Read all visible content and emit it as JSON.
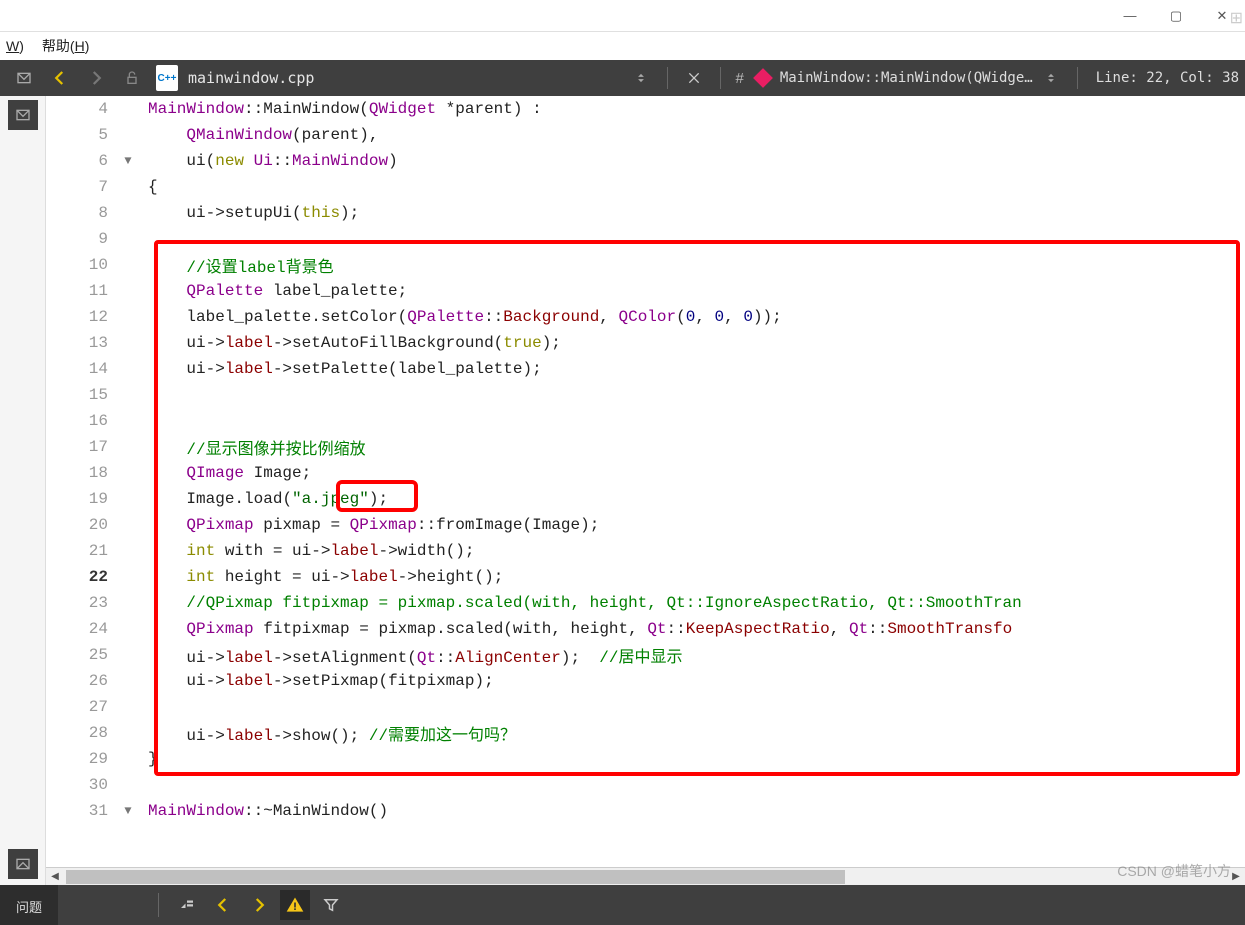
{
  "titlebar": {
    "min": "—",
    "max": "▢",
    "close": "✕"
  },
  "menu": {
    "item1_pre": "",
    "item1_u": "W",
    "item1_post": ")",
    "item2_pre": "帮助(",
    "item2_u": "H",
    "item2_post": ")"
  },
  "toolbar": {
    "filebadge": "C++",
    "filename": "mainwindow.cpp",
    "hash": "#",
    "symbol": "MainWindow::MainWindow(QWidge…",
    "lineinfo": "Line: 22, Col: 38"
  },
  "lines": [
    {
      "n": 4
    },
    {
      "n": 5
    },
    {
      "n": 6,
      "fold": true
    },
    {
      "n": 7
    },
    {
      "n": 8
    },
    {
      "n": 9
    },
    {
      "n": 10
    },
    {
      "n": 11
    },
    {
      "n": 12
    },
    {
      "n": 13
    },
    {
      "n": 14
    },
    {
      "n": 15
    },
    {
      "n": 16
    },
    {
      "n": 17
    },
    {
      "n": 18
    },
    {
      "n": 19
    },
    {
      "n": 20
    },
    {
      "n": 21
    },
    {
      "n": 22,
      "current": true
    },
    {
      "n": 23
    },
    {
      "n": 24
    },
    {
      "n": 25
    },
    {
      "n": 26
    },
    {
      "n": 27
    },
    {
      "n": 28
    },
    {
      "n": 29
    },
    {
      "n": 30
    },
    {
      "n": 31,
      "fold": true
    }
  ],
  "code": {
    "l4": [
      [
        "type",
        "MainWindow"
      ],
      [
        "op",
        "::"
      ],
      [
        "id",
        "MainWindow"
      ],
      [
        "op",
        "("
      ],
      [
        "type",
        "QWidget"
      ],
      [
        "op",
        " *"
      ],
      [
        "id",
        "parent"
      ],
      [
        "op",
        ") :"
      ]
    ],
    "l5": [
      [
        "op",
        "    "
      ],
      [
        "type",
        "QMainWindow"
      ],
      [
        "op",
        "("
      ],
      [
        "id",
        "parent"
      ],
      [
        "op",
        "),"
      ]
    ],
    "l6": [
      [
        "op",
        "    "
      ],
      [
        "id",
        "ui"
      ],
      [
        "op",
        "("
      ],
      [
        "key",
        "new"
      ],
      [
        "op",
        " "
      ],
      [
        "type",
        "Ui"
      ],
      [
        "op",
        "::"
      ],
      [
        "type",
        "MainWindow"
      ],
      [
        "op",
        ")"
      ]
    ],
    "l7": [
      [
        "op",
        "{"
      ]
    ],
    "l8": [
      [
        "op",
        "    "
      ],
      [
        "id",
        "ui"
      ],
      [
        "op",
        "->"
      ],
      [
        "id",
        "setupUi"
      ],
      [
        "op",
        "("
      ],
      [
        "key",
        "this"
      ],
      [
        "op",
        ");"
      ]
    ],
    "l9": [
      [
        "op",
        ""
      ]
    ],
    "l10": [
      [
        "op",
        "    "
      ],
      [
        "cmt",
        "//设置label背景色"
      ]
    ],
    "l11": [
      [
        "op",
        "    "
      ],
      [
        "type",
        "QPalette"
      ],
      [
        "op",
        " "
      ],
      [
        "id",
        "label_palette"
      ],
      [
        "op",
        ";"
      ]
    ],
    "l12": [
      [
        "op",
        "    "
      ],
      [
        "id",
        "label_palette"
      ],
      [
        "op",
        "."
      ],
      [
        "id",
        "setColor"
      ],
      [
        "op",
        "("
      ],
      [
        "type",
        "QPalette"
      ],
      [
        "op",
        "::"
      ],
      [
        "mem",
        "Background"
      ],
      [
        "op",
        ", "
      ],
      [
        "type",
        "QColor"
      ],
      [
        "op",
        "("
      ],
      [
        "num",
        "0"
      ],
      [
        "op",
        ", "
      ],
      [
        "num",
        "0"
      ],
      [
        "op",
        ", "
      ],
      [
        "num",
        "0"
      ],
      [
        "op",
        "));"
      ]
    ],
    "l13": [
      [
        "op",
        "    "
      ],
      [
        "id",
        "ui"
      ],
      [
        "op",
        "->"
      ],
      [
        "mem",
        "label"
      ],
      [
        "op",
        "->"
      ],
      [
        "id",
        "setAutoFillBackground"
      ],
      [
        "op",
        "("
      ],
      [
        "key",
        "true"
      ],
      [
        "op",
        ");"
      ]
    ],
    "l14": [
      [
        "op",
        "    "
      ],
      [
        "id",
        "ui"
      ],
      [
        "op",
        "->"
      ],
      [
        "mem",
        "label"
      ],
      [
        "op",
        "->"
      ],
      [
        "id",
        "setPalette"
      ],
      [
        "op",
        "("
      ],
      [
        "id",
        "label_palette"
      ],
      [
        "op",
        ");"
      ]
    ],
    "l15": [
      [
        "op",
        ""
      ]
    ],
    "l16": [
      [
        "op",
        ""
      ]
    ],
    "l17": [
      [
        "op",
        "    "
      ],
      [
        "cmt",
        "//显示图像并按比例缩放"
      ]
    ],
    "l18": [
      [
        "op",
        "    "
      ],
      [
        "type",
        "QImage"
      ],
      [
        "op",
        " "
      ],
      [
        "id",
        "Image"
      ],
      [
        "op",
        ";"
      ]
    ],
    "l19": [
      [
        "op",
        "    "
      ],
      [
        "id",
        "Image"
      ],
      [
        "op",
        "."
      ],
      [
        "id",
        "load"
      ],
      [
        "op",
        "("
      ],
      [
        "str",
        "\"a.jpeg\""
      ],
      [
        "op",
        ");"
      ]
    ],
    "l20": [
      [
        "op",
        "    "
      ],
      [
        "type",
        "QPixmap"
      ],
      [
        "op",
        " "
      ],
      [
        "id",
        "pixmap"
      ],
      [
        "op",
        " = "
      ],
      [
        "type",
        "QPixmap"
      ],
      [
        "op",
        "::"
      ],
      [
        "id",
        "fromImage"
      ],
      [
        "op",
        "("
      ],
      [
        "id",
        "Image"
      ],
      [
        "op",
        ");"
      ]
    ],
    "l21": [
      [
        "op",
        "    "
      ],
      [
        "key",
        "int"
      ],
      [
        "op",
        " "
      ],
      [
        "id",
        "with"
      ],
      [
        "op",
        " = "
      ],
      [
        "id",
        "ui"
      ],
      [
        "op",
        "->"
      ],
      [
        "mem",
        "label"
      ],
      [
        "op",
        "->"
      ],
      [
        "id",
        "width"
      ],
      [
        "op",
        "();"
      ]
    ],
    "l22": [
      [
        "op",
        "    "
      ],
      [
        "key",
        "int"
      ],
      [
        "op",
        " "
      ],
      [
        "id",
        "height"
      ],
      [
        "op",
        " = "
      ],
      [
        "id",
        "ui"
      ],
      [
        "op",
        "->"
      ],
      [
        "mem",
        "label"
      ],
      [
        "op",
        "->"
      ],
      [
        "id",
        "height"
      ],
      [
        "op",
        "();"
      ]
    ],
    "l23": [
      [
        "op",
        "    "
      ],
      [
        "cmt",
        "//QPixmap fitpixmap = pixmap.scaled(with, height, Qt::IgnoreAspectRatio, Qt::SmoothTran"
      ]
    ],
    "l24": [
      [
        "op",
        "    "
      ],
      [
        "type",
        "QPixmap"
      ],
      [
        "op",
        " "
      ],
      [
        "id",
        "fitpixmap"
      ],
      [
        "op",
        " = "
      ],
      [
        "id",
        "pixmap"
      ],
      [
        "op",
        "."
      ],
      [
        "id",
        "scaled"
      ],
      [
        "op",
        "("
      ],
      [
        "id",
        "with"
      ],
      [
        "op",
        ", "
      ],
      [
        "id",
        "height"
      ],
      [
        "op",
        ", "
      ],
      [
        "type",
        "Qt"
      ],
      [
        "op",
        "::"
      ],
      [
        "mem",
        "KeepAspectRatio"
      ],
      [
        "op",
        ", "
      ],
      [
        "type",
        "Qt"
      ],
      [
        "op",
        "::"
      ],
      [
        "mem",
        "SmoothTransfo"
      ]
    ],
    "l25": [
      [
        "op",
        "    "
      ],
      [
        "id",
        "ui"
      ],
      [
        "op",
        "->"
      ],
      [
        "mem",
        "label"
      ],
      [
        "op",
        "->"
      ],
      [
        "id",
        "setAlignment"
      ],
      [
        "op",
        "("
      ],
      [
        "type",
        "Qt"
      ],
      [
        "op",
        "::"
      ],
      [
        "mem",
        "AlignCenter"
      ],
      [
        "op",
        ");  "
      ],
      [
        "cmt",
        "//居中显示"
      ]
    ],
    "l26": [
      [
        "op",
        "    "
      ],
      [
        "id",
        "ui"
      ],
      [
        "op",
        "->"
      ],
      [
        "mem",
        "label"
      ],
      [
        "op",
        "->"
      ],
      [
        "id",
        "setPixmap"
      ],
      [
        "op",
        "("
      ],
      [
        "id",
        "fitpixmap"
      ],
      [
        "op",
        ");"
      ]
    ],
    "l27": [
      [
        "op",
        ""
      ]
    ],
    "l28": [
      [
        "op",
        "    "
      ],
      [
        "id",
        "ui"
      ],
      [
        "op",
        "->"
      ],
      [
        "mem",
        "label"
      ],
      [
        "op",
        "->"
      ],
      [
        "id",
        "show"
      ],
      [
        "op",
        "(); "
      ],
      [
        "cmt",
        "//需要加这一句吗？"
      ]
    ],
    "l29": [
      [
        "op",
        "}"
      ]
    ],
    "l30": [
      [
        "op",
        ""
      ]
    ],
    "l31": [
      [
        "type",
        "MainWindow"
      ],
      [
        "op",
        "::~"
      ],
      [
        "id",
        "MainWindow"
      ],
      [
        "op",
        "()"
      ]
    ]
  },
  "bottom": {
    "tab": "问题"
  },
  "watermark": "CSDN @蜡笔小方"
}
